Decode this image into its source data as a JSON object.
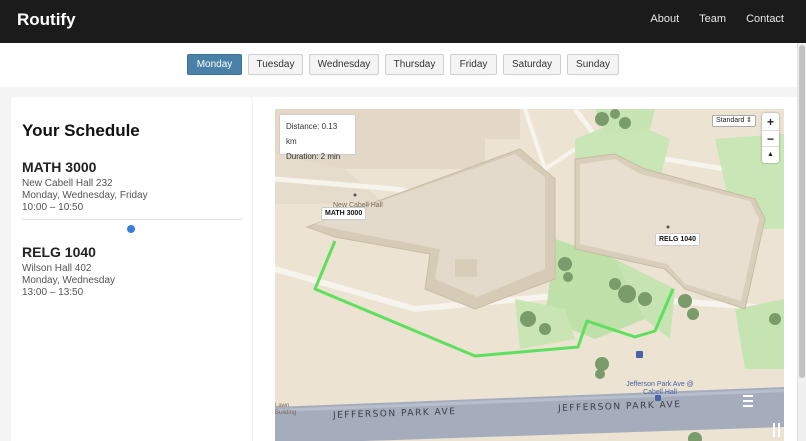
{
  "header": {
    "brand": "Routify",
    "nav": [
      "About",
      "Team",
      "Contact"
    ]
  },
  "days": {
    "items": [
      "Monday",
      "Tuesday",
      "Wednesday",
      "Thursday",
      "Friday",
      "Saturday",
      "Sunday"
    ],
    "selected": "Monday"
  },
  "schedule": {
    "title": "Your Schedule",
    "courses": [
      {
        "code": "MATH 3000",
        "location": "New Cabell Hall 232",
        "days": "Monday, Wednesday, Friday",
        "time": "10:00 – 10:50"
      },
      {
        "code": "RELG 1040",
        "location": "Wilson Hall 402",
        "days": "Monday, Wednesday",
        "time": "13:00 – 13:50"
      }
    ]
  },
  "map": {
    "distance": "Distance: 0.13 km",
    "duration": "Duration: 2 min",
    "style_option": "Standard",
    "zoom_in": "+",
    "zoom_out": "−",
    "compass": "▲",
    "markers": [
      "MATH 3000",
      "RELG 1040"
    ],
    "street": "JEFFERSON PARK AVE",
    "building_label": "New Cabell Hall",
    "stop_label": "Jefferson Park Ave @ Cabell Hall",
    "corner_label": "Lawn Building",
    "route_color": "#5ee05e",
    "accent": "#4a81a8"
  }
}
